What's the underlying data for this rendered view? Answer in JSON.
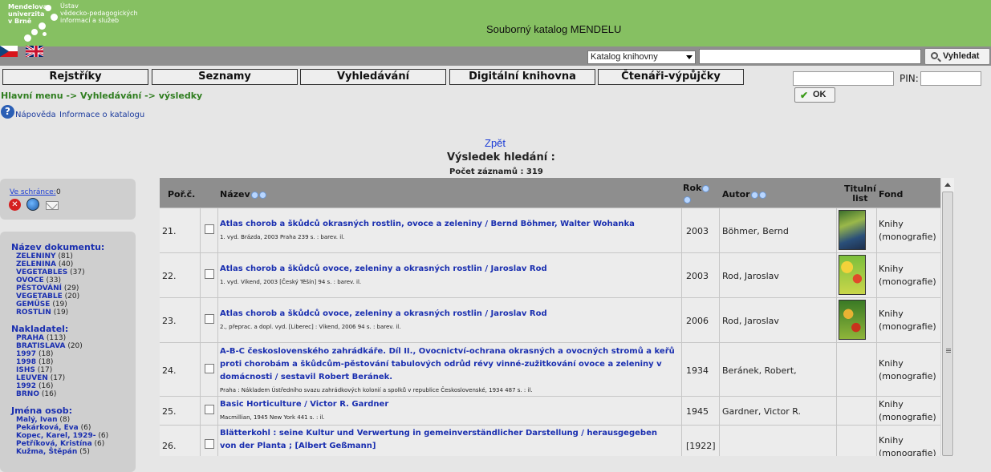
{
  "header": {
    "logo_text_left": "Mendelova\nuniverzita\nv Brně",
    "logo_text_right": "Ústav\nvědecko-pedagogických\ninformací a služeb",
    "title": "Souborný katalog MENDELU"
  },
  "search": {
    "catalog_selected": "Katalog knihovny",
    "query_value": "",
    "button_label": "Vyhledat"
  },
  "nav": {
    "tabs": [
      "Rejstříky",
      "Seznamy",
      "Vyhledávání",
      "Digitální knihovna",
      "Čtenáři-výpůjčky"
    ]
  },
  "login": {
    "pin_label": "PIN:",
    "ok_label": "OK"
  },
  "breadcrumb": "Hlavní menu -> Vyhledávání -> výsledky",
  "links": {
    "help": "Nápověda",
    "info": "Informace o katalogu",
    "back": "Zpět"
  },
  "results_header": {
    "heading": "Výsledek hledání :",
    "count_label": "Počet záznamů : 319"
  },
  "basket": {
    "label": "Ve schránce: ",
    "count": "0"
  },
  "facets": [
    {
      "heading": "Název dokumentu:",
      "items": [
        {
          "name": "ZELENINY",
          "count": "(81)"
        },
        {
          "name": "ZELENINA",
          "count": "(40)"
        },
        {
          "name": "VEGETABLES",
          "count": "(37)"
        },
        {
          "name": "OVOCE",
          "count": "(33)"
        },
        {
          "name": "PĚSTOVÁNÍ",
          "count": "(29)"
        },
        {
          "name": "VEGETABLE",
          "count": "(20)"
        },
        {
          "name": "GEMÜSE",
          "count": "(19)"
        },
        {
          "name": "ROSTLIN",
          "count": "(19)"
        }
      ]
    },
    {
      "heading": "Nakladatel:",
      "items": [
        {
          "name": "PRAHA",
          "count": "(113)"
        },
        {
          "name": "BRATISLAVA",
          "count": "(20)"
        },
        {
          "name": "1997",
          "count": "(18)"
        },
        {
          "name": "1998",
          "count": "(18)"
        },
        {
          "name": "ISHS",
          "count": "(17)"
        },
        {
          "name": "LEUVEN",
          "count": "(17)"
        },
        {
          "name": "1992",
          "count": "(16)"
        },
        {
          "name": "BRNO",
          "count": "(16)"
        }
      ]
    },
    {
      "heading": "Jména osob:",
      "items": [
        {
          "name": "Malý, Ivan",
          "count": "(8)"
        },
        {
          "name": "Pekárková, Eva",
          "count": "(6)"
        },
        {
          "name": "Kopec, Karel, 1929-",
          "count": "(6)"
        },
        {
          "name": "Petříková, Kristína",
          "count": "(6)"
        },
        {
          "name": "Kužma, Štěpán",
          "count": "(5)"
        }
      ]
    }
  ],
  "table": {
    "headers": {
      "num": "Poř.č.",
      "title": "Název",
      "year": "Rok",
      "author": "Autor",
      "cover_line1": "Titulní",
      "cover_line2": "list",
      "fond": "Fond"
    },
    "rows": [
      {
        "num": "21.",
        "title": "Atlas chorob a škůdců okrasných rostlin, ovoce a zeleniny / Bernd Böhmer, Walter Wohanka",
        "imprint": "1. vyd.  Brázda, 2003 Praha  239 s. : barev. il.",
        "year": "2003",
        "author": "Böhmer, Bernd",
        "fond1": "Knihy",
        "fond2": "(monografie)"
      },
      {
        "num": "22.",
        "title": "Atlas chorob a škůdců ovoce, zeleniny a okrasných rostlin / Jaroslav Rod",
        "imprint": "1. vyd.  Víkend, 2003 [Český Těšín]  94 s. : barev. il.",
        "year": "2003",
        "author": "Rod, Jaroslav",
        "fond1": "Knihy",
        "fond2": "(monografie)"
      },
      {
        "num": "23.",
        "title": "Atlas chorob a škůdců ovoce, zeleniny a okrasných rostlin / Jaroslav Rod",
        "imprint": "2., přeprac. a dopl. vyd.  [Liberec] : Víkend, 2006  94 s. : barev. il.",
        "year": "2006",
        "author": "Rod, Jaroslav",
        "fond1": "Knihy",
        "fond2": "(monografie)"
      },
      {
        "num": "24.",
        "title": "A-B-C československého zahrádkáře. Díl II., Ovocnictví-ochrana okrasných a ovocných stromů a keřů proti chorobám a škůdcům-pěstování tabulových odrůd révy vinné-zužitkování ovoce a zeleniny v domácnosti / sestavil Robert Beránek.",
        "imprint": "Praha : Nákladem Ústředního svazu zahrádkových kolonií a spolků v republice Československé, 1934  487 s. : il.",
        "year": "1934",
        "author": "Beránek, Robert,",
        "fond1": "Knihy",
        "fond2": "(monografie)"
      },
      {
        "num": "25.",
        "title": "Basic Horticulture / Victor R. Gardner",
        "imprint": "Macmillian, 1945 New York  441 s. : il.",
        "year": "1945",
        "author": "Gardner, Victor R.",
        "fond1": "Knihy",
        "fond2": "(monografie)"
      },
      {
        "num": "26.",
        "title": "Blätterkohl : seine Kultur und Verwertung in gemeinverständlicher Darstellung / herausgegeben von der Planta ; [Albert Geßmann]",
        "imprint": "",
        "year": "[1922]",
        "author": "",
        "fond1": "Knihy",
        "fond2": "(monografie)"
      }
    ]
  },
  "colors": {
    "header_green": "#86c062",
    "bar_gray": "#8e8e8e",
    "link_blue": "#1a2fb0",
    "breadcrumb_green": "#2e7d1e"
  }
}
